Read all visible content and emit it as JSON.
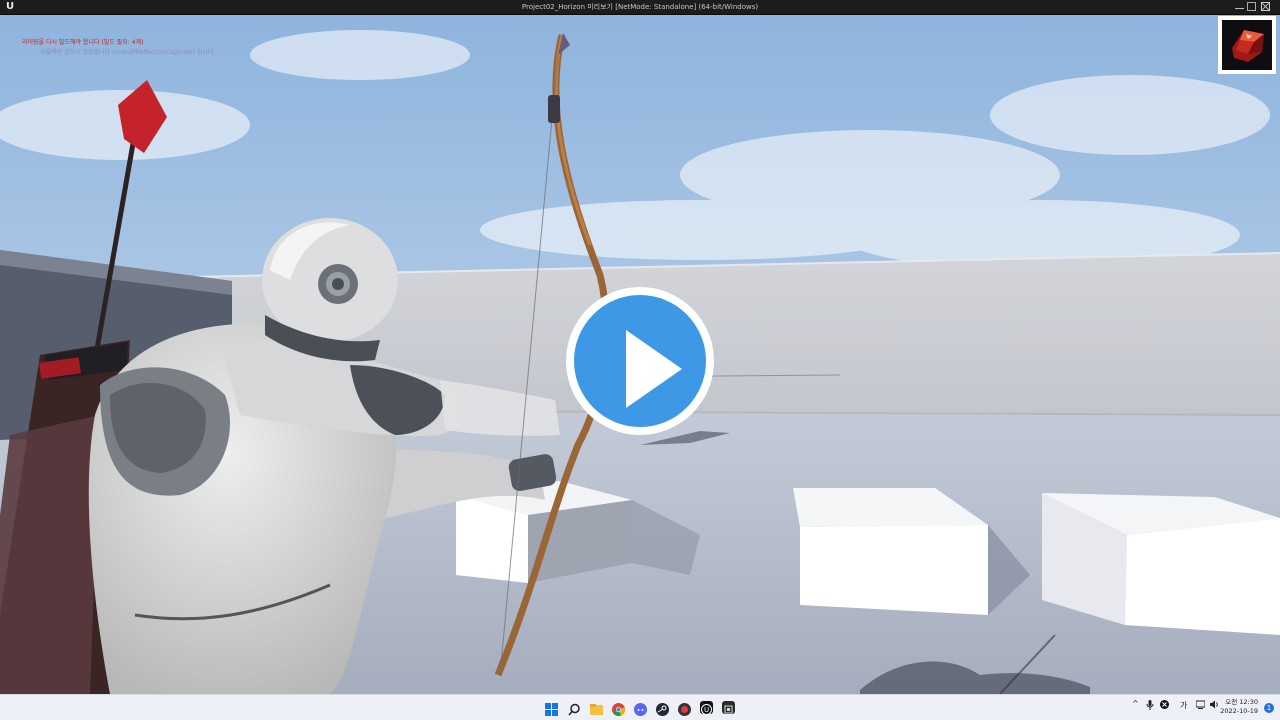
{
  "window": {
    "title": "Project02_Horizon 미리보기 [NetMode: Standalone] (64-bit/Windows)",
    "logo_text": "U"
  },
  "debug": {
    "line1": "라이팅을 다시 빌드해야 합니다 (빌드 필요: 4개)",
    "line2": "리플렉션 캡처가 필요합니다 (UnbuiltReflectionCaptures) 입니다"
  },
  "hud": {
    "item_icon": "red-crystal-icon"
  },
  "video": {
    "play_icon": "play-icon",
    "accent_color": "#3d98e6"
  },
  "taskbar": {
    "apps": [
      "windows-start-icon",
      "search-icon",
      "file-explorer-icon",
      "chrome-icon",
      "discord-icon",
      "steam-icon",
      "app-red-icon",
      "unreal-engine-icon",
      "app-dark-icon"
    ],
    "tray": {
      "overflow": "^",
      "clock_time": "오전 12:30",
      "clock_date": "2022-10-19",
      "notification_count": "1"
    }
  }
}
